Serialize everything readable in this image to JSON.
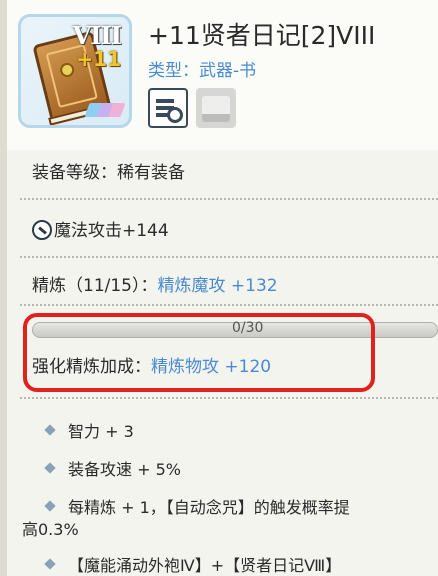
{
  "item": {
    "title": "+11贤者日记[2]VIII",
    "type_label": "类型：武器-书",
    "icon_grade": "VIII",
    "icon_refine": "+11"
  },
  "equip_level": "装备等级：稀有装备",
  "base_stat": "魔法攻击+144",
  "refine": {
    "label": "精炼（11/15）：",
    "bonus": "精炼魔攻 +132"
  },
  "enhance": {
    "progress_text": "0/30",
    "progress_fraction": 0,
    "label": "强化精炼加成：",
    "bonus": "精炼物攻 +120"
  },
  "effects": [
    "智力 + 3",
    "装备攻速 + 5%",
    "每精炼 + 1，【自动念咒】的触发概率提",
    "高0.3%",
    "【魔能涌动外袍Ⅳ】+【贤者日记Ⅷ】"
  ],
  "colors": {
    "accent_blue": "#4a8ad0",
    "highlight_red": "#e0221c",
    "frame_blue": "#b6d6ea"
  },
  "icons": {
    "inspect": "inspect-icon",
    "wardrobe": "wardrobe-icon",
    "magic_attack": "magic-attack-icon",
    "bullet": "diamond-bullet-icon"
  }
}
